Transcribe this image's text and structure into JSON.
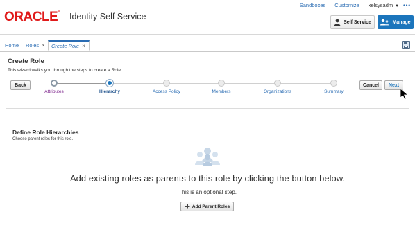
{
  "top_links": {
    "sandboxes": "Sandboxes",
    "customize": "Customize",
    "user": "xelsysadm",
    "more": "•••"
  },
  "header": {
    "logo_text": "ORACLE",
    "product_name": "Identity Self Service",
    "self_service_label": "Self Service",
    "manage_label": "Manage"
  },
  "tabs": [
    {
      "label": "Home",
      "closable": false
    },
    {
      "label": "Roles",
      "closable": true
    },
    {
      "label": "Create Role",
      "closable": true,
      "active": true
    }
  ],
  "close_glyph": "×",
  "page": {
    "title": "Create Role",
    "description": "This wizard walks you through the steps to create a Role."
  },
  "wizard": {
    "back_label": "Back",
    "cancel_label": "Cancel",
    "next_label": "Next",
    "steps": [
      {
        "label": "Attributes",
        "state": "visited"
      },
      {
        "label": "Hierarchy",
        "state": "current"
      },
      {
        "label": "Access Policy",
        "state": "future"
      },
      {
        "label": "Members",
        "state": "future"
      },
      {
        "label": "Organizations",
        "state": "future"
      },
      {
        "label": "Summary",
        "state": "future"
      }
    ]
  },
  "section": {
    "title": "Define Role Hierarchies",
    "subtitle": "Choose parent roles for this role.",
    "empty_message": "Add existing roles as parents to this role by clicking the button below.",
    "optional_note": "This is an optional step.",
    "add_button_label": "Add Parent Roles"
  },
  "colors": {
    "oracle_red": "#e01a1a",
    "accent_blue": "#1b75bc",
    "link_blue": "#2a6cb3",
    "visited_purple": "#7a1f8a"
  },
  "icons": {
    "self_service": "person-badge-icon",
    "manage": "users-manage-icon",
    "save": "save-disk-icon",
    "people": "role-people-icon",
    "add": "plus-icon"
  }
}
